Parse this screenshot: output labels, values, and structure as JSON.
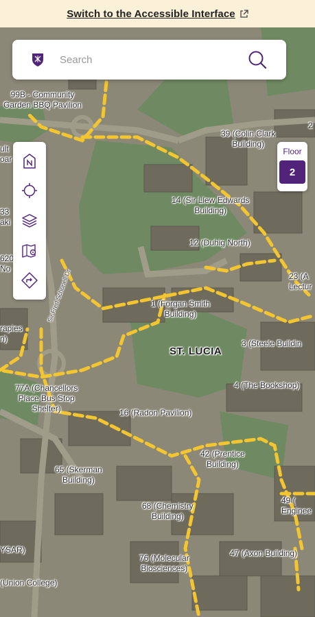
{
  "banner": {
    "link_text": "Switch to the Accessible Interface"
  },
  "search": {
    "placeholder": "Search"
  },
  "toolbar": {
    "buttons": [
      "north-compass",
      "locate-me",
      "layers",
      "map-legend",
      "directions"
    ]
  },
  "floor": {
    "label": "Floor",
    "value": "2"
  },
  "map": {
    "campus_label": "ST. LUCIA",
    "road_label": "Sir Fred Schonell Dr",
    "labels": [
      "99B - Community\nGarden BBQ Pavilion",
      "39 (Colin Clark\nBuilding)",
      "14 (Sir Llew Edwards\nBuilding)",
      "12 (Duhig North)",
      "23 (A\nLectur",
      "1 (Forgan Smith\nBuilding)",
      "3 (Steele Buildin",
      "4 (The Bookshop)",
      "77A (Chancellors\nPlace Bus Stop\nShelter)",
      "16 (Radon Pavilion)",
      "42 (Prentice\nBuilding)",
      "65 (Skerman\nBuilding)",
      "68 (Chemistry\nBuilding)",
      "49 (\nEnginee",
      "76 (Molecular\nBiosciences)",
      "47 (Axon Building)",
      "YSAR)",
      "(Union College)",
      "ult\noar",
      "33\naki",
      "620\nNo",
      "rapies\nn)",
      "2"
    ]
  },
  "colors": {
    "accent": "#51247a",
    "path": "#f3c531",
    "banner_bg": "#fbf1d8"
  }
}
